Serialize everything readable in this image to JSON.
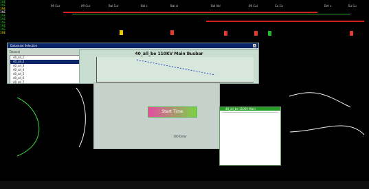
{
  "top_labels": [
    "69 Cur",
    "69 Cur",
    "Bal Cur",
    "Bal c",
    "Bal cl",
    "Bal Vol",
    "60 Cul",
    "Cu Cu",
    "Del c",
    "Eu Cu"
  ],
  "tiny_labels": [
    "1NE",
    "1NE",
    "1NE",
    "1NE",
    "1NE",
    "1NE",
    "1NE",
    "1NE",
    "1NE",
    "1NE"
  ],
  "dialog": {
    "title": "Datamsat Selection",
    "selector": "Datasel",
    "items": [
      "40_all_1",
      "40_all_2",
      "40_all_3",
      "40_all_4",
      "40_all_5",
      "40_all_6",
      "40_all_7"
    ],
    "chart_title": "40_all_be 110KV Main Busbar"
  },
  "main_panel": {
    "button": "Start Time",
    "status": "100 Dstur"
  },
  "right_panel": {
    "title": "40_all_be 110KV Main"
  },
  "colors": {
    "background": "#000000",
    "dialog": "#c7d6cb",
    "selection": "#0a246a",
    "button": "#e64ca2",
    "green": "#27b827",
    "red": "#d21f1f",
    "yellow": "#efc900"
  },
  "chart_data": {
    "type": "line",
    "title": "40_all_be 110KV Main Busbar",
    "x": [
      0,
      1
    ],
    "series": [
      {
        "values": [
          1,
          0
        ]
      }
    ]
  }
}
